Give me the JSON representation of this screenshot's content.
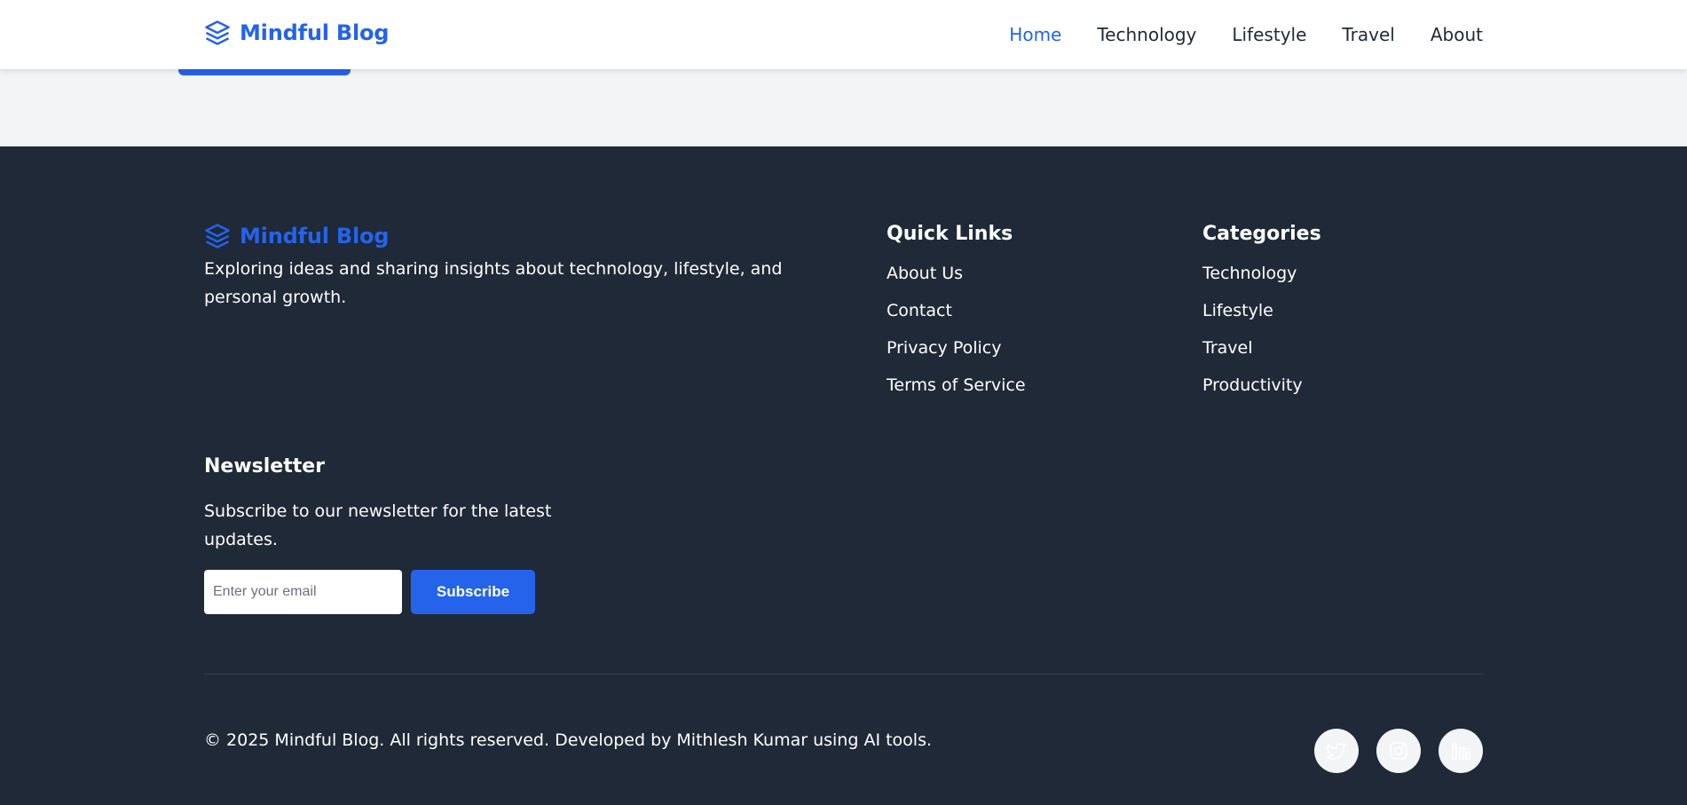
{
  "header": {
    "brand": "Mindful Blog",
    "nav": [
      "Home",
      "Technology",
      "Lifestyle",
      "Travel",
      "About"
    ],
    "active_nav": "Home"
  },
  "footer": {
    "brand": "Mindful Blog",
    "description": "Exploring ideas and sharing insights about technology, lifestyle, and personal growth.",
    "quick_links": {
      "title": "Quick Links",
      "items": [
        "About Us",
        "Contact",
        "Privacy Policy",
        "Terms of Service"
      ]
    },
    "categories": {
      "title": "Categories",
      "items": [
        "Technology",
        "Lifestyle",
        "Travel",
        "Productivity"
      ]
    },
    "newsletter": {
      "title": "Newsletter",
      "text": "Subscribe to our newsletter for the latest updates.",
      "placeholder": "Enter your email",
      "button": "Subscribe"
    },
    "copyright": "© 2025 Mindful Blog. All rights reserved. Developed by Mithlesh Kumar using AI tools.",
    "social": [
      "twitter-icon",
      "instagram-icon",
      "linkedin-icon"
    ]
  },
  "colors": {
    "accent": "#2563eb",
    "footer_bg": "#1f2937",
    "page_bg": "#f3f4f6"
  }
}
